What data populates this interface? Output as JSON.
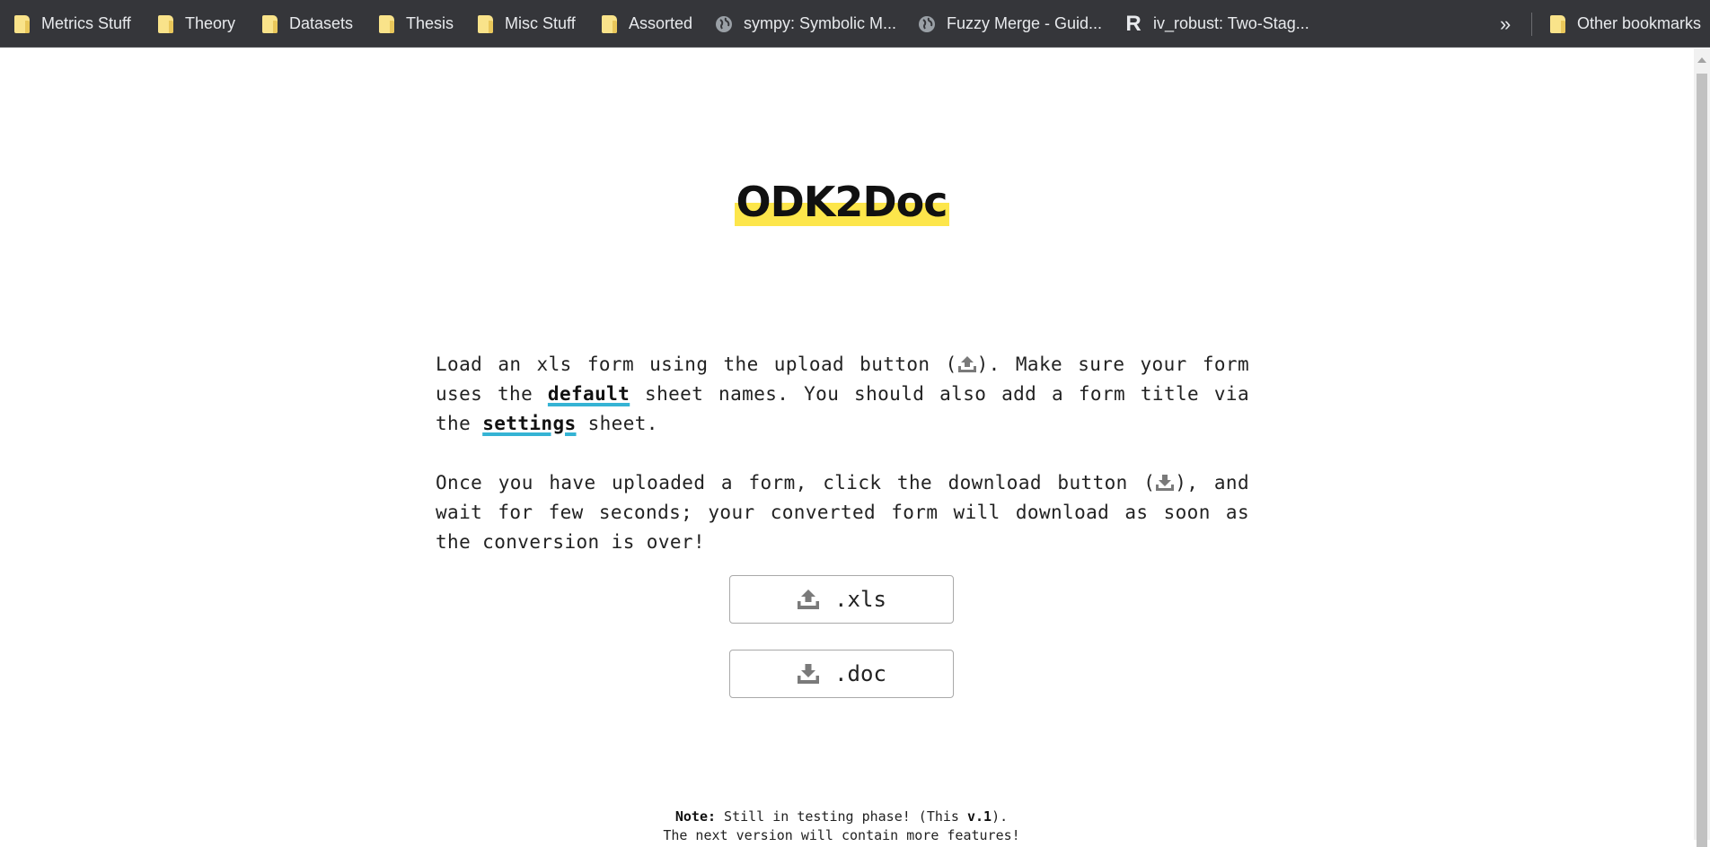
{
  "bookmarks": {
    "items": [
      {
        "label": "Metrics Stuff",
        "icon": "folder-icon"
      },
      {
        "label": "Theory",
        "icon": "folder-icon"
      },
      {
        "label": "Datasets",
        "icon": "folder-icon"
      },
      {
        "label": "Thesis",
        "icon": "folder-icon"
      },
      {
        "label": "Misc Stuff",
        "icon": "folder-icon"
      },
      {
        "label": "Assorted",
        "icon": "folder-icon"
      },
      {
        "label": "sympy: Symbolic M...",
        "icon": "globe-icon"
      },
      {
        "label": "Fuzzy Merge - Guid...",
        "icon": "globe-icon"
      },
      {
        "label": "iv_robust: Two-Stag...",
        "icon": "r-logo-icon"
      }
    ],
    "overflow": "»",
    "other": {
      "label": "Other bookmarks",
      "icon": "folder-icon"
    }
  },
  "page": {
    "title": "ODK2Doc",
    "intro": {
      "p1_before": "Load an xls form using the upload button (",
      "p1_mid1": "). Make sure your form uses the ",
      "p1_kw1": "default",
      "p1_mid2": " sheet names. You should also add a form title via the ",
      "p1_kw2": "settings",
      "p1_after": " sheet.",
      "p2_before": "Once you have uploaded a form, click the download button (",
      "p2_after": "), and wait for few seconds; your converted form will download as soon as the conversion is over!"
    },
    "upload_button": {
      "label": ".xls",
      "icon": "upload-icon"
    },
    "download_button": {
      "label": ".doc",
      "icon": "download-icon"
    },
    "note": {
      "label": "Note:",
      "text1": " Still in testing phase! (This ",
      "version": "v.1",
      "text2": ").",
      "line2": "The next version will contain more features!"
    }
  },
  "colors": {
    "bar_bg": "#35363a",
    "title_highlight": "#fde64b",
    "keyword_underline": "#35b3d4",
    "folder": "#f9e38a"
  }
}
